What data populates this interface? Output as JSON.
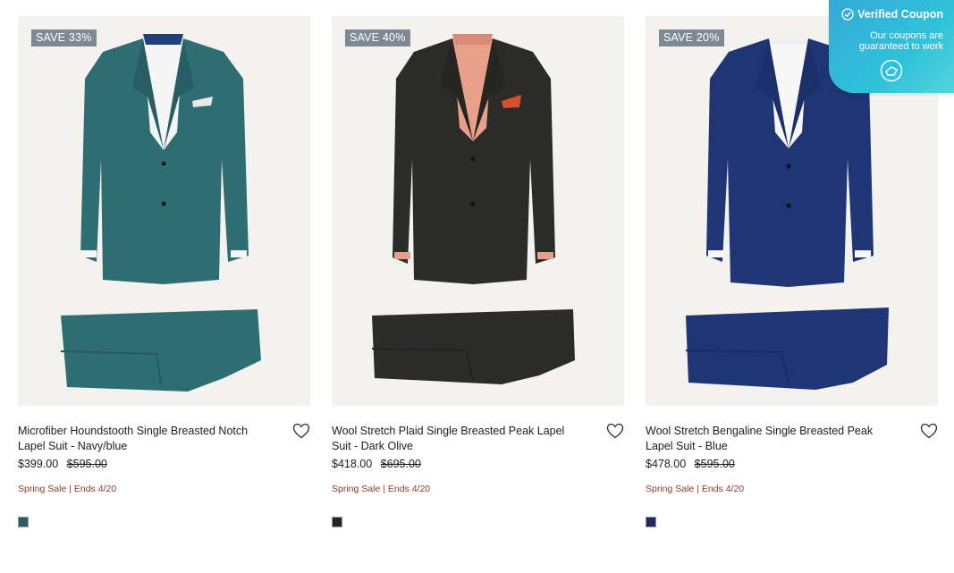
{
  "coupon": {
    "title": "Verified Coupon",
    "subtitle": "Our coupons are guaranteed to work"
  },
  "products": [
    {
      "badge": "SAVE 33%",
      "title": "Microfiber Houndstooth Single Breasted Notch Lapel Suit - Navy/blue",
      "sale_price": "$399.00",
      "original_price": "$595.00",
      "promo": "Spring Sale | Ends 4/20",
      "swatch_color": "#2f5a6a"
    },
    {
      "badge": "SAVE 40%",
      "title": "Wool Stretch Plaid Single Breasted Peak Lapel Suit - Dark Olive",
      "sale_price": "$418.00",
      "original_price": "$695.00",
      "promo": "Spring Sale | Ends 4/20",
      "swatch_color": "#262626"
    },
    {
      "badge": "SAVE 20%",
      "title": "Wool Stretch Bengaline Single Breasted Peak Lapel Suit - Blue",
      "sale_price": "$478.00",
      "original_price": "$595.00",
      "promo": "Spring Sale | Ends 4/20",
      "swatch_color": "#1f2c57"
    }
  ]
}
